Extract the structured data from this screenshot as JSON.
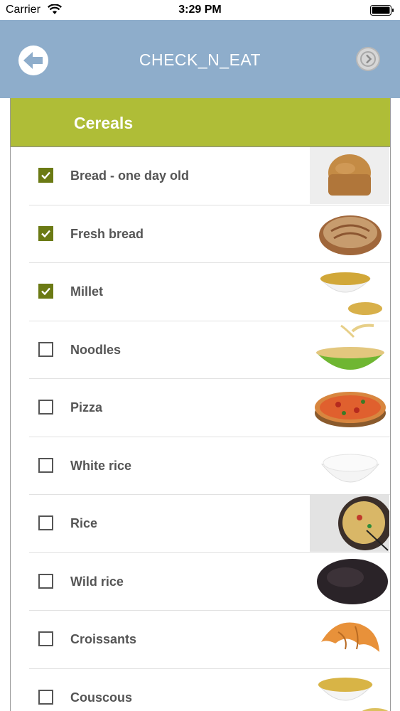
{
  "status_bar": {
    "carrier": "Carrier",
    "time": "3:29 PM"
  },
  "nav": {
    "title": "CHECK_N_EAT",
    "back_icon": "arrow-left-icon",
    "next_icon": "chevron-right-icon"
  },
  "section": {
    "title": "Cereals"
  },
  "colors": {
    "nav_bg": "#8eadcb",
    "header_bg": "#afbd37",
    "check": "#6b7a14"
  },
  "items": [
    {
      "label": "Bread - one day old",
      "checked": true,
      "image": "bread-loaf-image"
    },
    {
      "label": "Fresh bread",
      "checked": true,
      "image": "rustic-bread-image"
    },
    {
      "label": "Millet",
      "checked": true,
      "image": "millet-bowl-image"
    },
    {
      "label": "Noodles",
      "checked": false,
      "image": "noodles-bowl-image"
    },
    {
      "label": "Pizza",
      "checked": false,
      "image": "pizza-image"
    },
    {
      "label": "White rice",
      "checked": false,
      "image": "white-rice-bowl-image"
    },
    {
      "label": "Rice",
      "checked": false,
      "image": "fried-rice-bowl-image"
    },
    {
      "label": "Wild rice",
      "checked": false,
      "image": "wild-rice-image"
    },
    {
      "label": "Croissants",
      "checked": false,
      "image": "croissant-image"
    },
    {
      "label": "Couscous",
      "checked": false,
      "image": "couscous-bowl-image"
    }
  ]
}
